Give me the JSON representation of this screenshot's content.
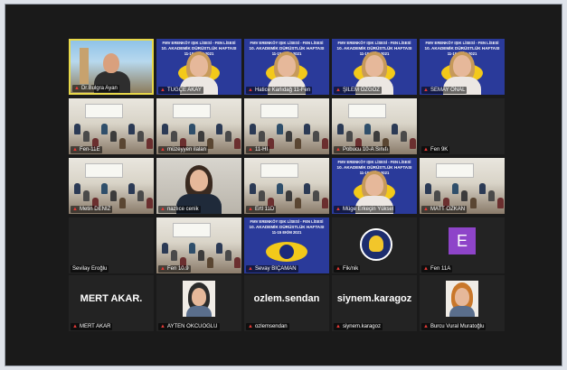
{
  "meeting": {
    "tiles": [
      {
        "name": "Dr.Bulgra Ayan",
        "kind": "video-host"
      },
      {
        "name": "TUĞÇE AKAY",
        "kind": "poster-person"
      },
      {
        "name": "Hatice Karlıdağ 11-Fen",
        "kind": "poster-person"
      },
      {
        "name": "ŞİLEM ÖZGÖZ",
        "kind": "poster-person"
      },
      {
        "name": "SEMAY ÖNAL",
        "kind": "poster-person"
      },
      {
        "name": "Fen-11E",
        "kind": "classroom"
      },
      {
        "name": "müzeyyen ilalan",
        "kind": "classroom"
      },
      {
        "name": "11-HI",
        "kind": "classroom"
      },
      {
        "name": "Pobucu 10-A Sınıfı",
        "kind": "classroom"
      },
      {
        "name": "Fen 9K",
        "kind": "dark"
      },
      {
        "name": "Metin DENİZ",
        "kind": "classroom"
      },
      {
        "name": "nazlıce cenik",
        "kind": "video-person"
      },
      {
        "name": "Ertl 11D",
        "kind": "classroom"
      },
      {
        "name": "Müge Erkeçin Yüksel",
        "kind": "poster-person"
      },
      {
        "name": "MATT ÖZKAN",
        "kind": "classroom"
      },
      {
        "name": "Sevilay Eroğlu",
        "kind": "dark"
      },
      {
        "name": "Fen 10.9",
        "kind": "classroom"
      },
      {
        "name": "Sevay BİÇAMAN",
        "kind": "poster"
      },
      {
        "name": "Fik/nik",
        "kind": "emblem"
      },
      {
        "name": "Fen 11A",
        "kind": "avatar",
        "initial": "E"
      },
      {
        "name": "MERT AKAR",
        "kind": "text",
        "big": "MERT AKAR."
      },
      {
        "name": "AYTEN OKCUOĞLU",
        "kind": "photo"
      },
      {
        "name": "ozlemsendan",
        "kind": "text",
        "big": "ozlem.sendan"
      },
      {
        "name": "siynem.karagoz",
        "kind": "text",
        "big": "siynem.karagoz"
      },
      {
        "name": "Burcu Vural Muratoğlu",
        "kind": "photo"
      }
    ],
    "poster_lines": [
      "FMV ERENKÖY IŞIK LİSESİ - FEN LİSESİ",
      "10. AKADEMİK DÜRÜSTLÜK HAFTASI",
      "11-15 EKİM 2021"
    ]
  },
  "colors": {
    "frame_bg": "#1a1a1a",
    "tile_bg": "#232323",
    "active_border": "#e8d84a",
    "poster_blue": "#2a3a9a",
    "mic_muted": "#e53935",
    "avatar_purple": "#8e44c9"
  }
}
